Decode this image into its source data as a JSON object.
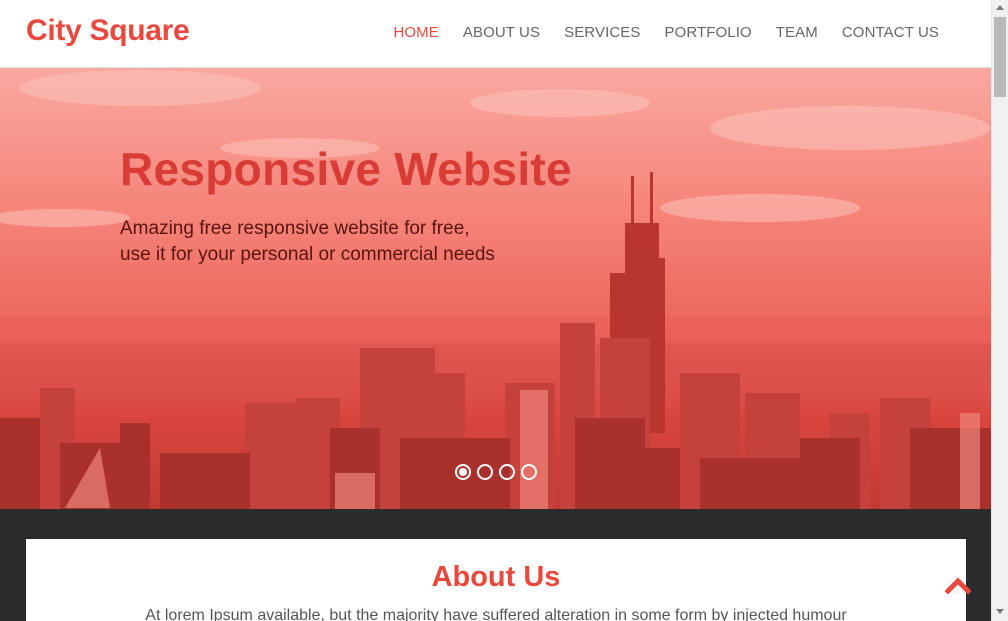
{
  "header": {
    "logo": "City Square",
    "nav": [
      {
        "label": "HOME",
        "active": true
      },
      {
        "label": "ABOUT US",
        "active": false
      },
      {
        "label": "SERVICES",
        "active": false
      },
      {
        "label": "PORTFOLIO",
        "active": false
      },
      {
        "label": "TEAM",
        "active": false
      },
      {
        "label": "CONTACT US",
        "active": false
      }
    ]
  },
  "hero": {
    "title": "Responsive Website",
    "subtitle_line1": "Amazing free responsive website for free,",
    "subtitle_line2": "use it for your personal or commercial needs",
    "slides": 4,
    "active_slide": 1
  },
  "about": {
    "title": "About Us",
    "text": "At lorem Ipsum available, but the majority have suffered alteration in some form by injected humour"
  },
  "icons": {
    "to_top": "chevron-up-icon"
  },
  "colors": {
    "accent": "#e8493c",
    "dark_bg": "#2b2b2b"
  }
}
